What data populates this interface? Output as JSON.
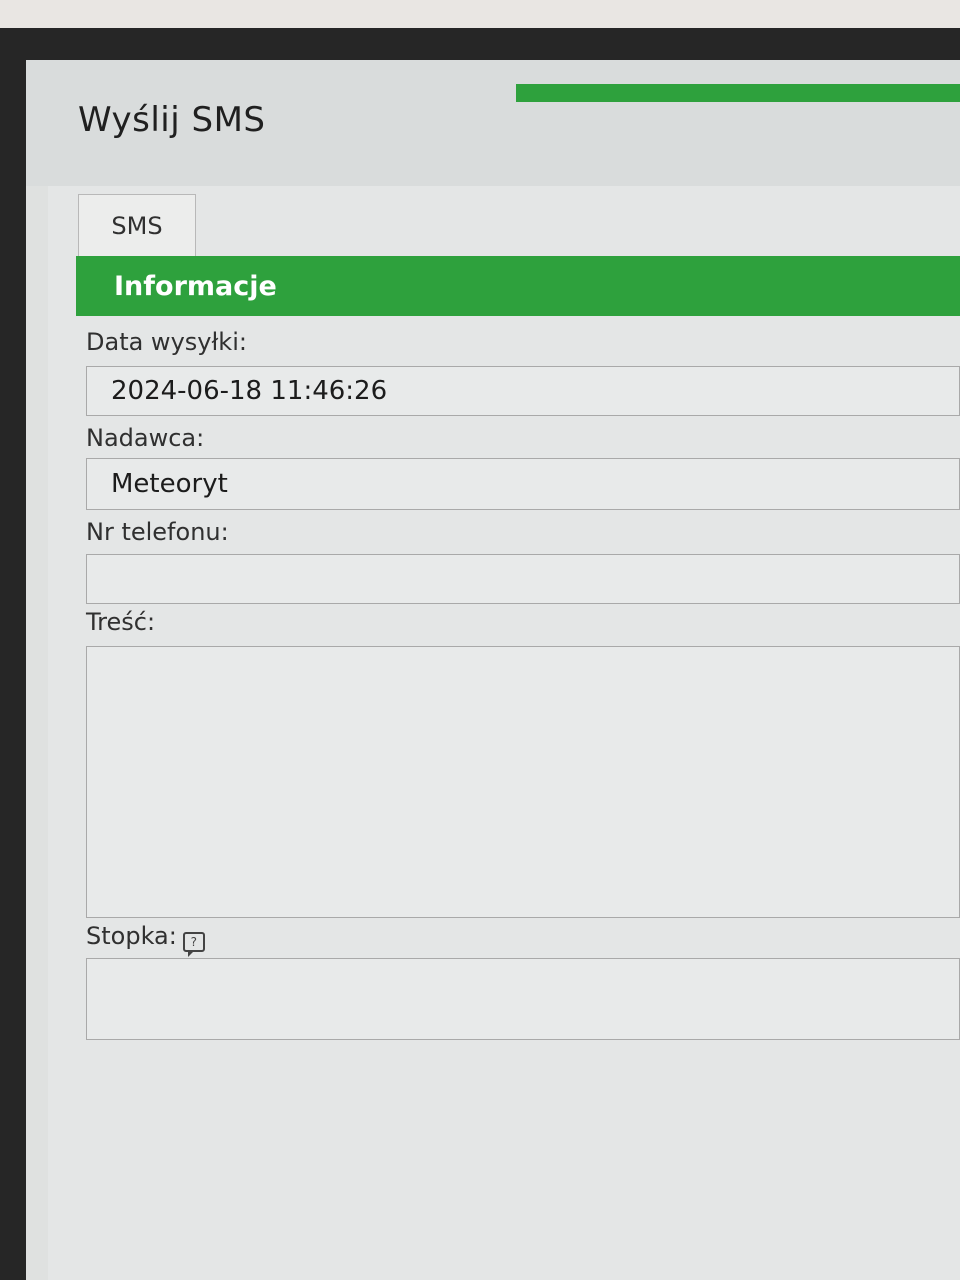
{
  "window": {
    "title": "Wyślij SMS"
  },
  "tabs": [
    {
      "label": "SMS"
    }
  ],
  "section": {
    "title": "Informacje"
  },
  "form": {
    "send_date": {
      "label": "Data wysyłki:",
      "value": "2024-06-18 11:46:26"
    },
    "sender": {
      "label": "Nadawca:",
      "value": "Meteoryt"
    },
    "phone": {
      "label": "Nr telefonu:",
      "value": ""
    },
    "content": {
      "label": "Treść:",
      "value": ""
    },
    "footer": {
      "label": "Stopka:",
      "value": "",
      "icon": "comment-question-icon",
      "icon_glyph": "?"
    }
  },
  "colors": {
    "accent": "#2ea13d",
    "header_text": "#ffffff"
  }
}
